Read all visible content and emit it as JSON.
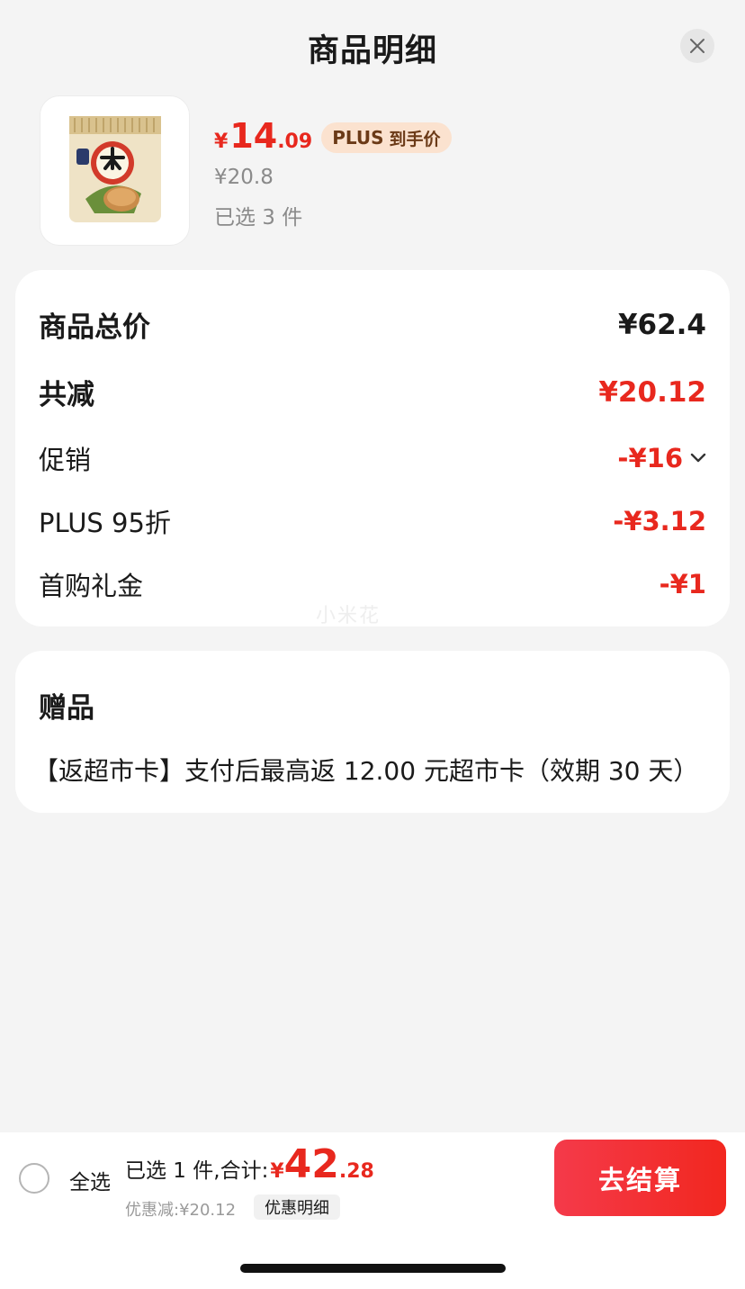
{
  "header": {
    "title": "商品明细"
  },
  "product": {
    "price_symbol": "¥",
    "price_int": "14",
    "price_dec": ".09",
    "plus_label": "PLUS",
    "plus_sub": "到手价",
    "original_price": "¥20.8",
    "selected_count": "已选 3 件"
  },
  "summary": {
    "rows": [
      {
        "label": "商品总价",
        "value": "¥62.4"
      },
      {
        "label": "共减",
        "value": "¥20.12"
      },
      {
        "label": "促销",
        "value": "-¥16"
      },
      {
        "label": "PLUS 95折",
        "value": "-¥3.12"
      },
      {
        "label": "首购礼金",
        "value": "-¥1"
      }
    ],
    "watermark": "小米花"
  },
  "gifts": {
    "title": "赠品",
    "text": "【返超市卡】支付后最高返 12.00 元超市卡（效期 30 天）"
  },
  "bottom_bar": {
    "select_all": "全选",
    "total_text": "已选 1 件,合计:",
    "total_symbol": "¥",
    "total_int": "42",
    "total_dec": ".28",
    "discount_text": "优惠减:¥20.12",
    "discount_detail_button": "优惠明细",
    "checkout_button": "去结算"
  },
  "colors": {
    "accent_red": "#e8281e",
    "plus_badge_bg": "#fbe2cf",
    "page_bg": "#f4f4f4"
  },
  "icons": [
    "close-icon",
    "chevron-down-icon"
  ]
}
